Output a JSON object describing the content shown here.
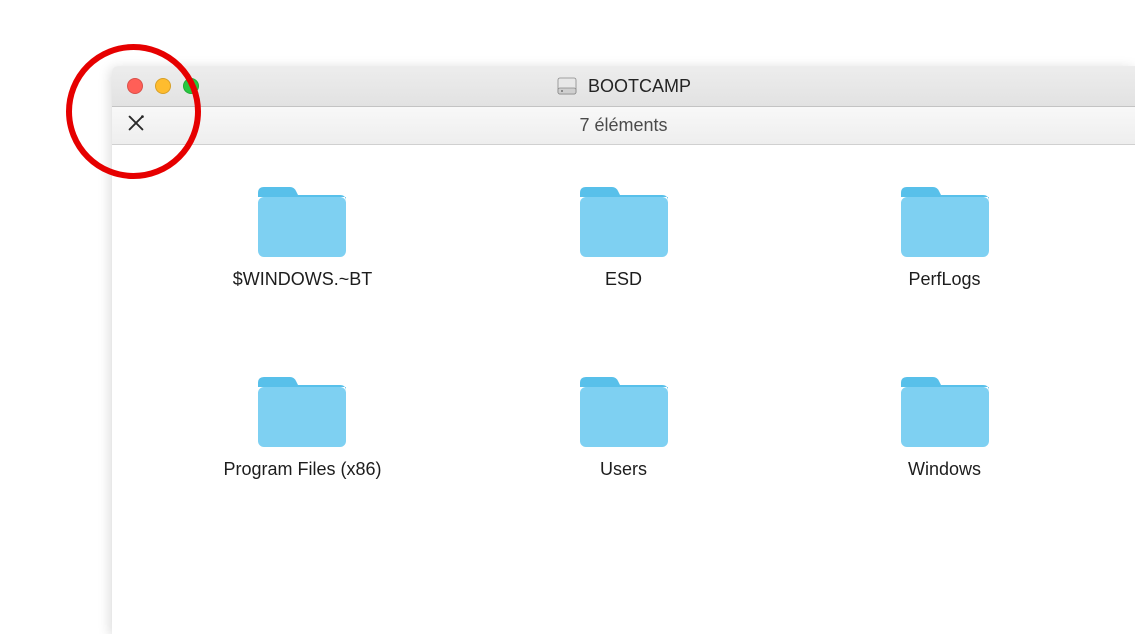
{
  "window": {
    "title": "BOOTCAMP",
    "status": "7 éléments"
  },
  "folders": [
    {
      "name": "$WINDOWS.~BT"
    },
    {
      "name": "ESD"
    },
    {
      "name": "PerfLogs"
    },
    {
      "name": "Program Files (x86)"
    },
    {
      "name": "Users"
    },
    {
      "name": "Windows"
    }
  ]
}
